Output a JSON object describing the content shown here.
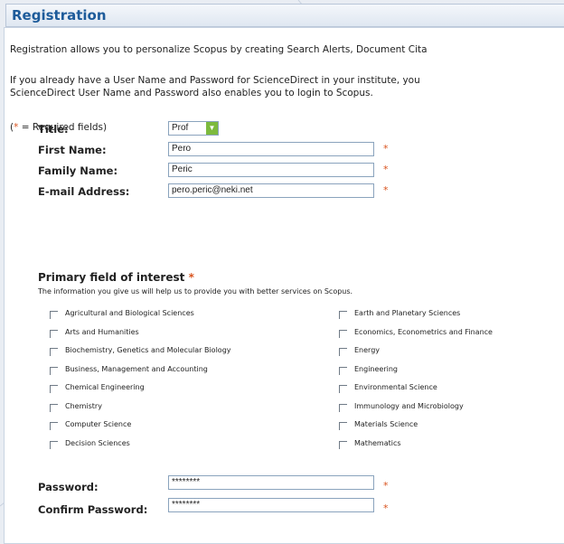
{
  "header": {
    "title": "Registration"
  },
  "intro": {
    "line1": "Registration allows you to personalize Scopus by creating Search Alerts, Document Cita",
    "line2": "If you already have a User Name and Password for ScienceDirect in your institute, you",
    "line3": "ScienceDirect User Name and Password also enables you to login to Scopus.",
    "required_star": "*",
    "required_note": " = Required fields)",
    "required_open": "("
  },
  "form": {
    "title_label": "Title:",
    "title_value": "Prof",
    "first_name_label": "First Name:",
    "first_name_value": "Pero",
    "family_name_label": "Family Name:",
    "family_name_value": "Peric",
    "email_label": "E-mail Address:",
    "email_value": "pero.peric@neki.net",
    "required_marker": "*",
    "password_label": "Password:",
    "password_value": "********",
    "confirm_password_label": "Confirm Password:",
    "confirm_password_value": "********"
  },
  "interest": {
    "title": "Primary field of interest",
    "star": "*",
    "note": "The information you give us will help us to provide you with better services on Scopus.",
    "left": [
      "Agricultural and Biological Sciences",
      "Arts and Humanities",
      "Biochemistry, Genetics and Molecular Biology",
      "Business, Management and Accounting",
      "Chemical Engineering",
      "Chemistry",
      "Computer Science",
      "Decision Sciences"
    ],
    "right": [
      "Earth and Planetary Sciences",
      "Economics, Econometrics and Finance",
      "Energy",
      "Engineering",
      "Environmental Science",
      "Immunology and Microbiology",
      "Materials Science",
      "Mathematics"
    ]
  },
  "colors": {
    "accent": "#1d5b9a",
    "required": "#d9531e",
    "select_arrow": "#7dba3e"
  }
}
